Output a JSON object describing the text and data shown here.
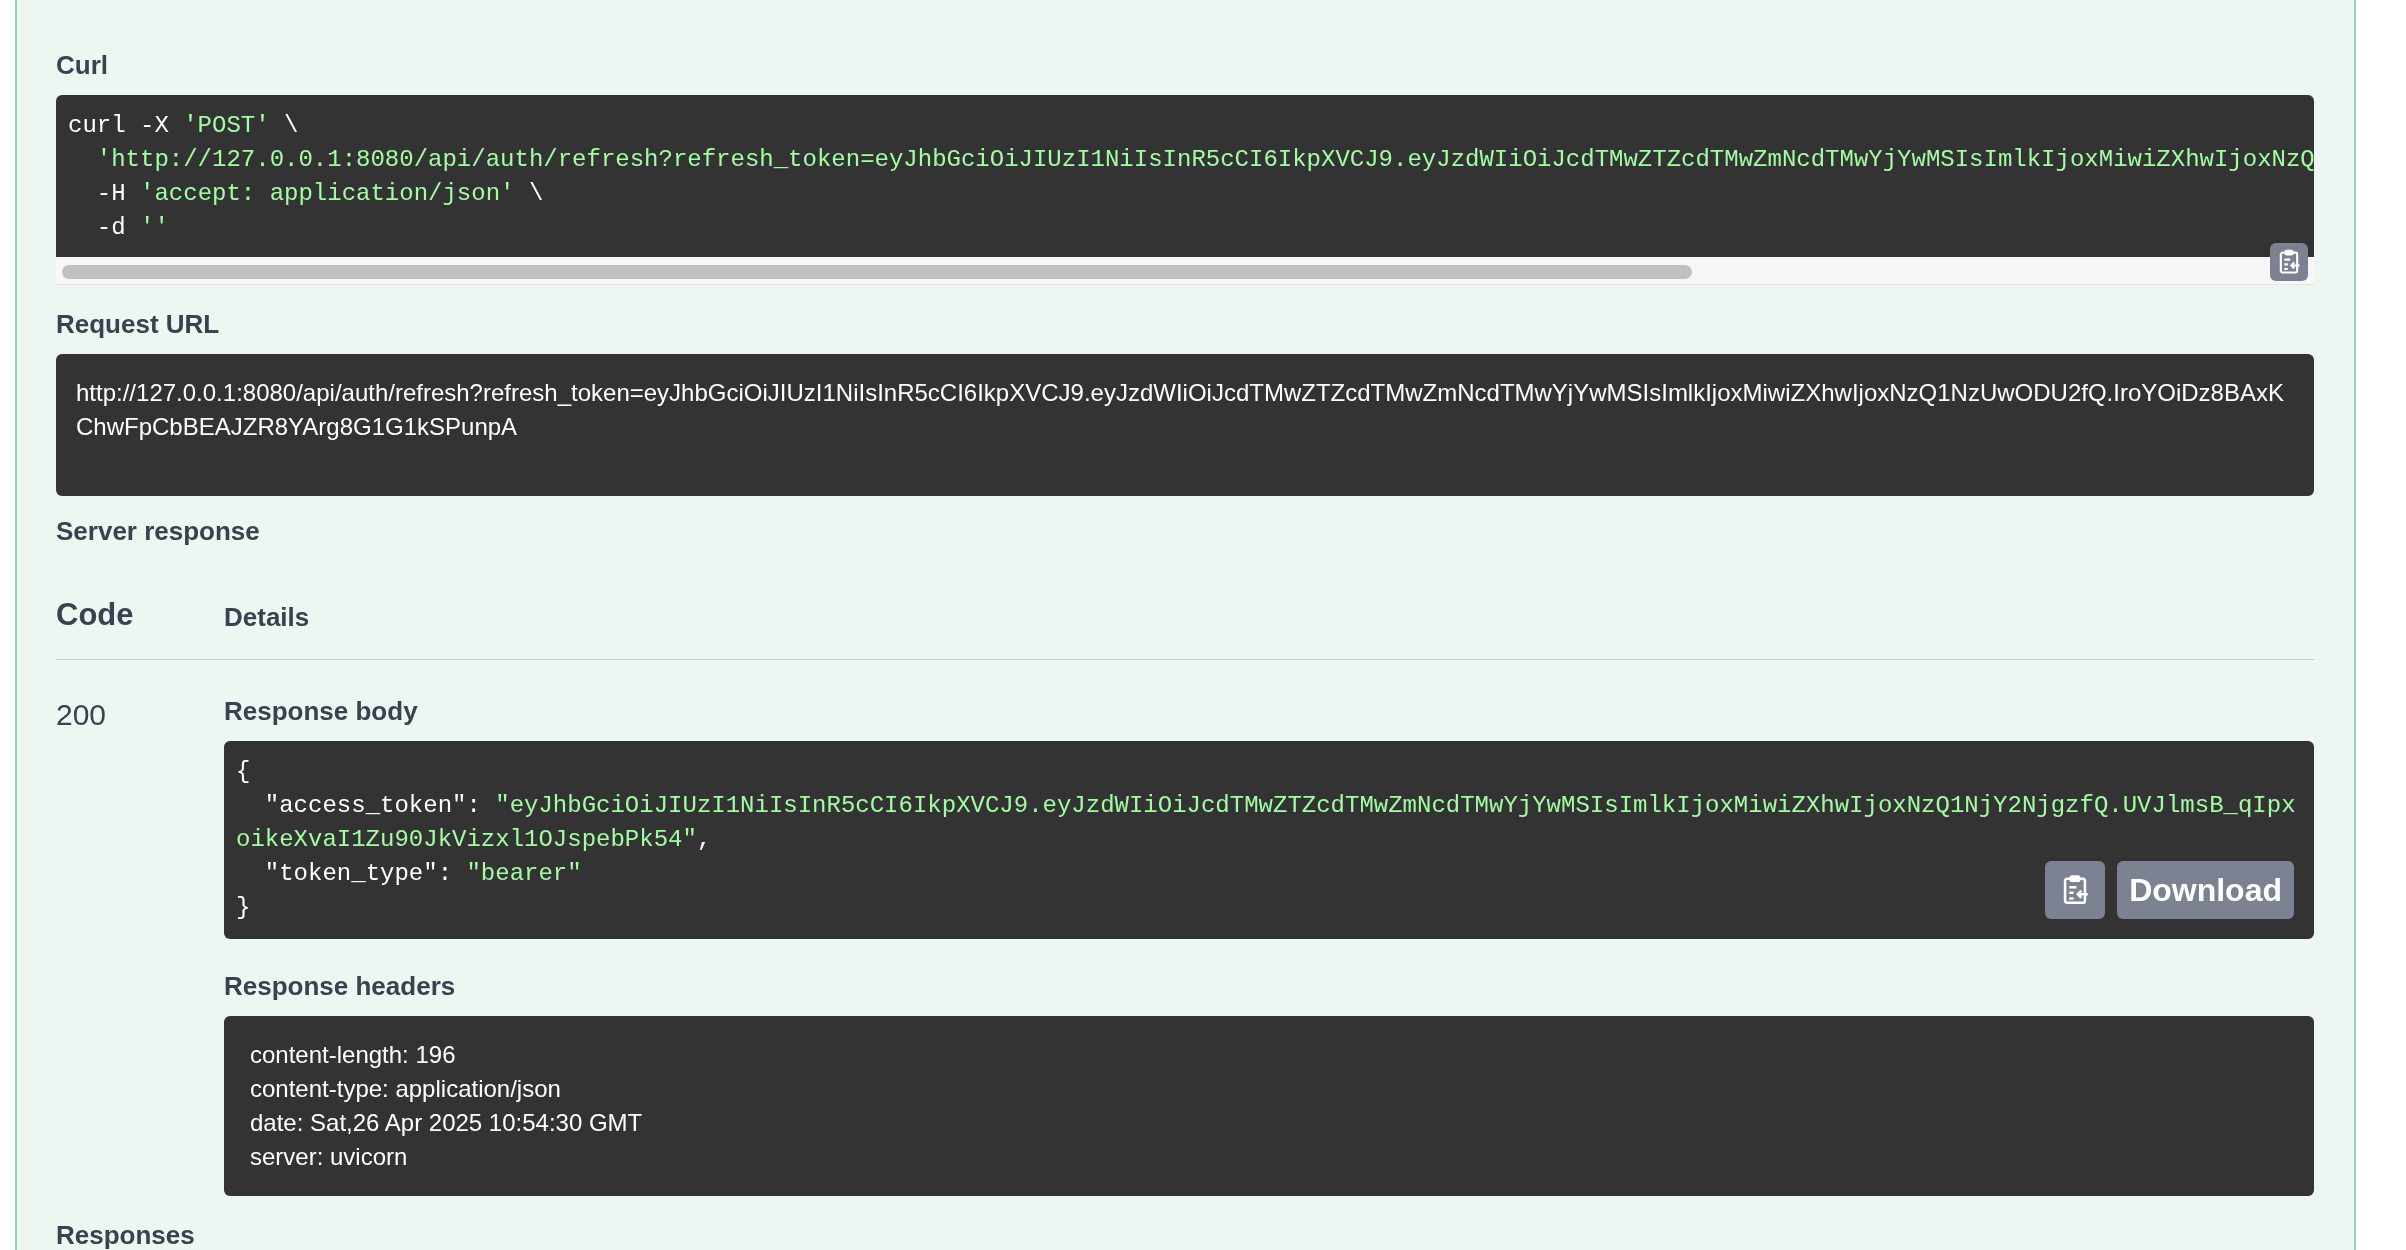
{
  "curl": {
    "label": "Curl",
    "lines": [
      [
        {
          "kind": "plain",
          "text": "curl -X "
        },
        {
          "kind": "string",
          "text": "'POST'"
        },
        {
          "kind": "plain",
          "text": " \\"
        }
      ],
      [
        {
          "kind": "string",
          "text": "  'http://127.0.0.1:8080/api/auth/refresh?refresh_token=eyJhbGciOiJIUzI1NiIsInR5cCI6IkpXVCJ9.eyJzdWIiOiJcdTMwZTZcdTMwZmNcdTMwYjYwMSIsImlkIjoxMiwiZXhwIjoxNzQ"
        }
      ],
      [
        {
          "kind": "plain",
          "text": "  -H "
        },
        {
          "kind": "string",
          "text": "'accept: application/json'"
        },
        {
          "kind": "plain",
          "text": " \\"
        }
      ],
      [
        {
          "kind": "plain",
          "text": "  -d "
        },
        {
          "kind": "string",
          "text": "''"
        }
      ]
    ]
  },
  "request_url": {
    "label": "Request URL",
    "value": "http://127.0.0.1:8080/api/auth/refresh?refresh_token=eyJhbGciOiJIUzI1NiIsInR5cCI6IkpXVCJ9.eyJzdWIiOiJcdTMwZTZcdTMwZmNcdTMwYjYwMSIsImlkIjoxMiwiZXhwIjoxNzQ1NzUwODU2fQ.IroYOiDz8BAxKChwFpCbBEAJZR8YArg8G1G1kSPunpA"
  },
  "server_response": {
    "label": "Server response",
    "columns": [
      "Code",
      "Details"
    ],
    "code": "200",
    "body": {
      "label": "Response body",
      "lines": [
        [
          {
            "kind": "plain",
            "text": "{"
          }
        ],
        [
          {
            "kind": "plain",
            "text": "  \"access_token\": "
          },
          {
            "kind": "string",
            "text": "\"eyJhbGciOiJIUzI1NiIsInR5cCI6IkpXVCJ9.eyJzdWIiOiJcdTMwZTZcdTMwZmNcdTMwYjYwMSIsImlkIjoxMiwiZXhwIjoxNzQ1NjY2NjgzfQ.UVJlmsB_qIpxoikeXvaI1Zu90JkVizxl1OJspebPk54\""
          },
          {
            "kind": "plain",
            "text": ","
          }
        ],
        [
          {
            "kind": "plain",
            "text": "  \"token_type\": "
          },
          {
            "kind": "string",
            "text": "\"bearer\""
          }
        ],
        [
          {
            "kind": "plain",
            "text": "}"
          }
        ]
      ],
      "download": "Download"
    },
    "headers": {
      "label": "Response headers",
      "lines": [
        "content-length: 196",
        "content-type: application/json",
        "date: Sat,26 Apr 2025 10:54:30 GMT",
        "server: uvicorn"
      ]
    }
  },
  "responses_label": "Responses"
}
